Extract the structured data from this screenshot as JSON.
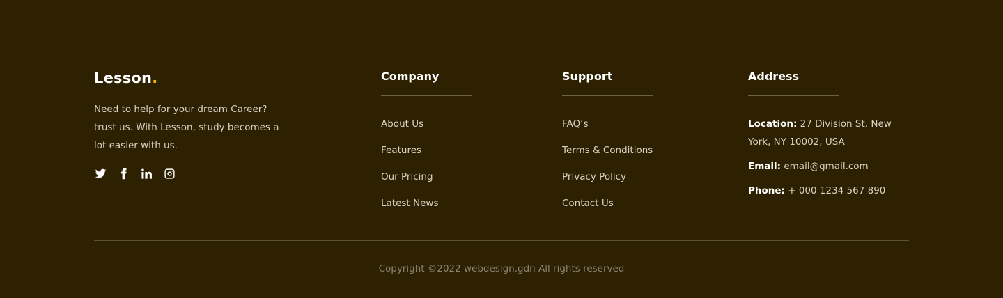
{
  "brand": {
    "logo_text": "Lesson",
    "logo_dot": ".",
    "tagline": "Need to help for your dream Career? trust us. With Lesson, study becomes a lot easier with us.",
    "socials": [
      "twitter-icon",
      "facebook-icon",
      "linkedin-icon",
      "instagram-icon"
    ]
  },
  "company": {
    "title": "Company",
    "links": [
      "About Us",
      "Features",
      "Our Pricing",
      "Latest News"
    ]
  },
  "support": {
    "title": "Support",
    "links": [
      "FAQ’s",
      "Terms & Conditions",
      "Privacy Policy",
      "Contact Us"
    ]
  },
  "address": {
    "title": "Address",
    "location_label": "Location:",
    "location_value": " 27 Division St, New York, NY 10002, USA",
    "email_label": "Email:",
    "email_value": " email@gmail.com",
    "phone_label": "Phone:",
    "phone_value": " + 000 1234 567 890"
  },
  "copyright": "Copyright ©2022 webdesign.gdn All rights reserved",
  "colors": {
    "background": "#2e2102",
    "accent": "#f5b800"
  }
}
